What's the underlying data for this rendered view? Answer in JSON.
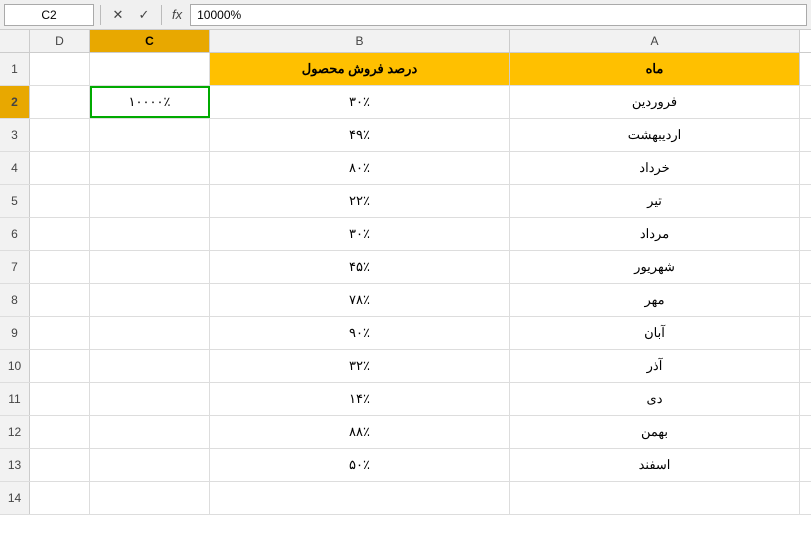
{
  "toolbar": {
    "cell_ref": "C2",
    "formula_value": "10000%",
    "fx_symbol": "fx"
  },
  "columns": {
    "d_label": "D",
    "c_label": "C",
    "b_label": "B",
    "a_label": "A"
  },
  "headers": {
    "col_b": "درصد فروش محصول",
    "col_a": "ماه"
  },
  "rows": [
    {
      "num": "2",
      "c": "۱۰۰۰۰٪",
      "b": "۳۰٪",
      "a": "فروردین"
    },
    {
      "num": "3",
      "c": "",
      "b": "۴۹٪",
      "a": "اردیبهشت"
    },
    {
      "num": "4",
      "c": "",
      "b": "۸۰٪",
      "a": "خرداد"
    },
    {
      "num": "5",
      "c": "",
      "b": "۲۲٪",
      "a": "تیر"
    },
    {
      "num": "6",
      "c": "",
      "b": "۳۰٪",
      "a": "مرداد"
    },
    {
      "num": "7",
      "c": "",
      "b": "۴۵٪",
      "a": "شهریور"
    },
    {
      "num": "8",
      "c": "",
      "b": "۷۸٪",
      "a": "مهر"
    },
    {
      "num": "9",
      "c": "",
      "b": "۹۰٪",
      "a": "آبان"
    },
    {
      "num": "10",
      "c": "",
      "b": "۳۲٪",
      "a": "آذر"
    },
    {
      "num": "11",
      "c": "",
      "b": "۱۴٪",
      "a": "دی"
    },
    {
      "num": "12",
      "c": "",
      "b": "۸۸٪",
      "a": "بهمن"
    },
    {
      "num": "13",
      "c": "",
      "b": "۵۰٪",
      "a": "اسفند"
    }
  ],
  "row14_num": "14"
}
